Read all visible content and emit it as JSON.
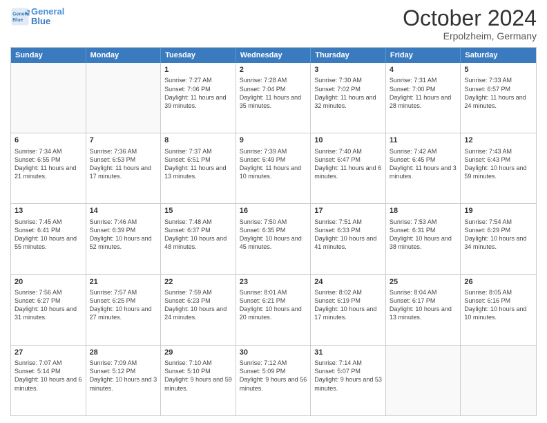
{
  "header": {
    "logo_line1": "General",
    "logo_line2": "Blue",
    "month": "October 2024",
    "location": "Erpolzheim, Germany"
  },
  "days": [
    "Sunday",
    "Monday",
    "Tuesday",
    "Wednesday",
    "Thursday",
    "Friday",
    "Saturday"
  ],
  "rows": [
    [
      {
        "day": "",
        "empty": true
      },
      {
        "day": "",
        "empty": true
      },
      {
        "day": "1",
        "sunrise": "Sunrise: 7:27 AM",
        "sunset": "Sunset: 7:06 PM",
        "daylight": "Daylight: 11 hours and 39 minutes."
      },
      {
        "day": "2",
        "sunrise": "Sunrise: 7:28 AM",
        "sunset": "Sunset: 7:04 PM",
        "daylight": "Daylight: 11 hours and 35 minutes."
      },
      {
        "day": "3",
        "sunrise": "Sunrise: 7:30 AM",
        "sunset": "Sunset: 7:02 PM",
        "daylight": "Daylight: 11 hours and 32 minutes."
      },
      {
        "day": "4",
        "sunrise": "Sunrise: 7:31 AM",
        "sunset": "Sunset: 7:00 PM",
        "daylight": "Daylight: 11 hours and 28 minutes."
      },
      {
        "day": "5",
        "sunrise": "Sunrise: 7:33 AM",
        "sunset": "Sunset: 6:57 PM",
        "daylight": "Daylight: 11 hours and 24 minutes."
      }
    ],
    [
      {
        "day": "6",
        "sunrise": "Sunrise: 7:34 AM",
        "sunset": "Sunset: 6:55 PM",
        "daylight": "Daylight: 11 hours and 21 minutes."
      },
      {
        "day": "7",
        "sunrise": "Sunrise: 7:36 AM",
        "sunset": "Sunset: 6:53 PM",
        "daylight": "Daylight: 11 hours and 17 minutes."
      },
      {
        "day": "8",
        "sunrise": "Sunrise: 7:37 AM",
        "sunset": "Sunset: 6:51 PM",
        "daylight": "Daylight: 11 hours and 13 minutes."
      },
      {
        "day": "9",
        "sunrise": "Sunrise: 7:39 AM",
        "sunset": "Sunset: 6:49 PM",
        "daylight": "Daylight: 11 hours and 10 minutes."
      },
      {
        "day": "10",
        "sunrise": "Sunrise: 7:40 AM",
        "sunset": "Sunset: 6:47 PM",
        "daylight": "Daylight: 11 hours and 6 minutes."
      },
      {
        "day": "11",
        "sunrise": "Sunrise: 7:42 AM",
        "sunset": "Sunset: 6:45 PM",
        "daylight": "Daylight: 11 hours and 3 minutes."
      },
      {
        "day": "12",
        "sunrise": "Sunrise: 7:43 AM",
        "sunset": "Sunset: 6:43 PM",
        "daylight": "Daylight: 10 hours and 59 minutes."
      }
    ],
    [
      {
        "day": "13",
        "sunrise": "Sunrise: 7:45 AM",
        "sunset": "Sunset: 6:41 PM",
        "daylight": "Daylight: 10 hours and 55 minutes."
      },
      {
        "day": "14",
        "sunrise": "Sunrise: 7:46 AM",
        "sunset": "Sunset: 6:39 PM",
        "daylight": "Daylight: 10 hours and 52 minutes."
      },
      {
        "day": "15",
        "sunrise": "Sunrise: 7:48 AM",
        "sunset": "Sunset: 6:37 PM",
        "daylight": "Daylight: 10 hours and 48 minutes."
      },
      {
        "day": "16",
        "sunrise": "Sunrise: 7:50 AM",
        "sunset": "Sunset: 6:35 PM",
        "daylight": "Daylight: 10 hours and 45 minutes."
      },
      {
        "day": "17",
        "sunrise": "Sunrise: 7:51 AM",
        "sunset": "Sunset: 6:33 PM",
        "daylight": "Daylight: 10 hours and 41 minutes."
      },
      {
        "day": "18",
        "sunrise": "Sunrise: 7:53 AM",
        "sunset": "Sunset: 6:31 PM",
        "daylight": "Daylight: 10 hours and 38 minutes."
      },
      {
        "day": "19",
        "sunrise": "Sunrise: 7:54 AM",
        "sunset": "Sunset: 6:29 PM",
        "daylight": "Daylight: 10 hours and 34 minutes."
      }
    ],
    [
      {
        "day": "20",
        "sunrise": "Sunrise: 7:56 AM",
        "sunset": "Sunset: 6:27 PM",
        "daylight": "Daylight: 10 hours and 31 minutes."
      },
      {
        "day": "21",
        "sunrise": "Sunrise: 7:57 AM",
        "sunset": "Sunset: 6:25 PM",
        "daylight": "Daylight: 10 hours and 27 minutes."
      },
      {
        "day": "22",
        "sunrise": "Sunrise: 7:59 AM",
        "sunset": "Sunset: 6:23 PM",
        "daylight": "Daylight: 10 hours and 24 minutes."
      },
      {
        "day": "23",
        "sunrise": "Sunrise: 8:01 AM",
        "sunset": "Sunset: 6:21 PM",
        "daylight": "Daylight: 10 hours and 20 minutes."
      },
      {
        "day": "24",
        "sunrise": "Sunrise: 8:02 AM",
        "sunset": "Sunset: 6:19 PM",
        "daylight": "Daylight: 10 hours and 17 minutes."
      },
      {
        "day": "25",
        "sunrise": "Sunrise: 8:04 AM",
        "sunset": "Sunset: 6:17 PM",
        "daylight": "Daylight: 10 hours and 13 minutes."
      },
      {
        "day": "26",
        "sunrise": "Sunrise: 8:05 AM",
        "sunset": "Sunset: 6:16 PM",
        "daylight": "Daylight: 10 hours and 10 minutes."
      }
    ],
    [
      {
        "day": "27",
        "sunrise": "Sunrise: 7:07 AM",
        "sunset": "Sunset: 5:14 PM",
        "daylight": "Daylight: 10 hours and 6 minutes."
      },
      {
        "day": "28",
        "sunrise": "Sunrise: 7:09 AM",
        "sunset": "Sunset: 5:12 PM",
        "daylight": "Daylight: 10 hours and 3 minutes."
      },
      {
        "day": "29",
        "sunrise": "Sunrise: 7:10 AM",
        "sunset": "Sunset: 5:10 PM",
        "daylight": "Daylight: 9 hours and 59 minutes."
      },
      {
        "day": "30",
        "sunrise": "Sunrise: 7:12 AM",
        "sunset": "Sunset: 5:09 PM",
        "daylight": "Daylight: 9 hours and 56 minutes."
      },
      {
        "day": "31",
        "sunrise": "Sunrise: 7:14 AM",
        "sunset": "Sunset: 5:07 PM",
        "daylight": "Daylight: 9 hours and 53 minutes."
      },
      {
        "day": "",
        "empty": true
      },
      {
        "day": "",
        "empty": true
      }
    ]
  ]
}
